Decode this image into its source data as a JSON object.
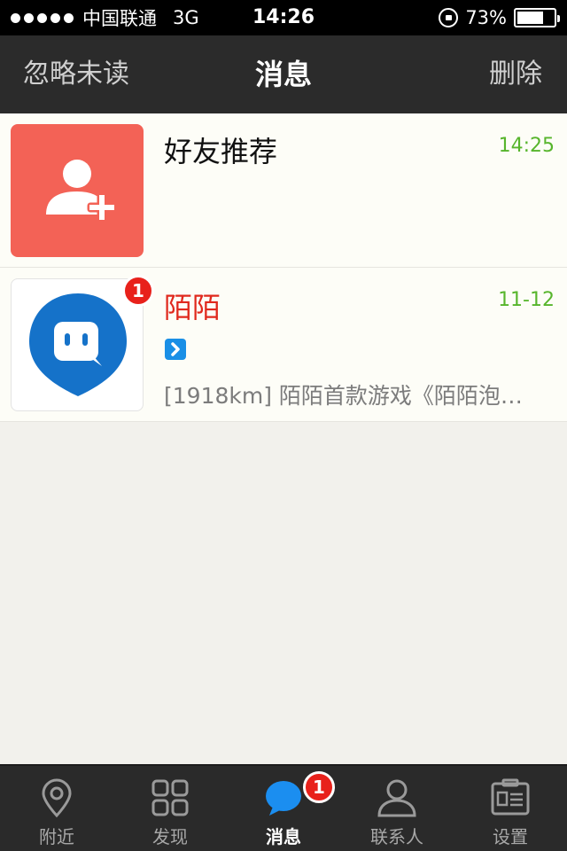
{
  "status_bar": {
    "carrier": "中国联通",
    "network": "3G",
    "time": "14:26",
    "battery": "73%",
    "battery_level": 0.73
  },
  "nav": {
    "left_action": "忽略未读",
    "title": "消息",
    "right_action": "删除"
  },
  "messages": [
    {
      "title": "好友推荐",
      "time": "14:25",
      "avatar_icon": "add-user-icon",
      "avatar_color": "#f36256"
    },
    {
      "title": "陌陌",
      "time": "11-12",
      "badge": "1",
      "avatar_icon": "momo-logo",
      "preview": "[1918km] 陌陌首款游戏《陌陌泡…",
      "title_color": "#e0291e"
    }
  ],
  "tabs": [
    {
      "label": "附近",
      "icon": "location-pin-icon"
    },
    {
      "label": "发现",
      "icon": "grid-icon"
    },
    {
      "label": "消息",
      "icon": "chat-bubble-icon",
      "badge": "1",
      "active": true
    },
    {
      "label": "联系人",
      "icon": "person-icon"
    },
    {
      "label": "设置",
      "icon": "id-card-icon"
    }
  ],
  "colors": {
    "accent_blue": "#1a8fe6",
    "time_green": "#57b52c",
    "badge_red": "#e8211b"
  }
}
